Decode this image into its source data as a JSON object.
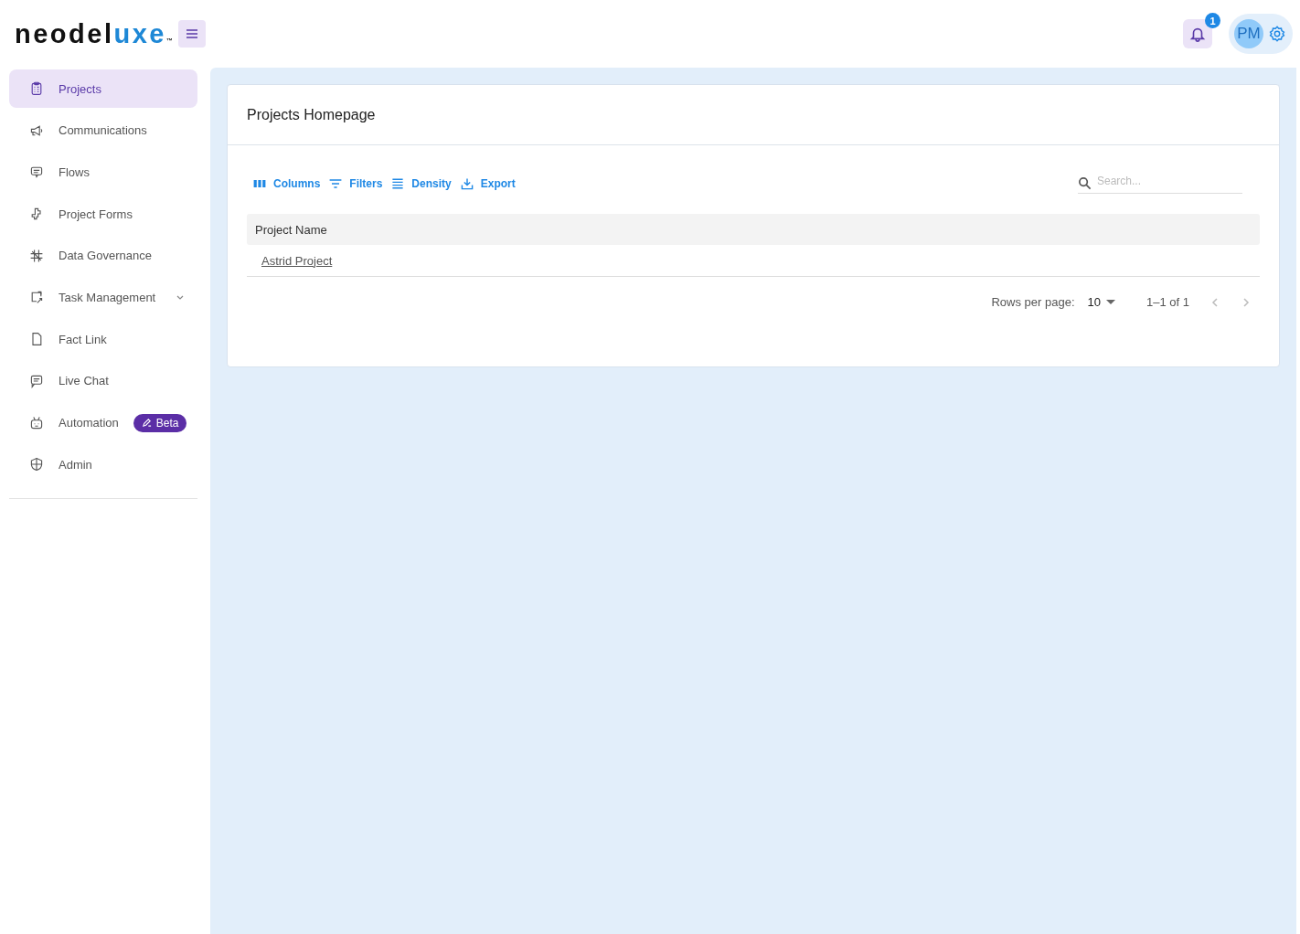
{
  "logo": {
    "text": "neodel",
    "accent": "uxe",
    "mark": "™"
  },
  "header": {
    "notifications": "1",
    "avatar": "PM"
  },
  "sidebar": {
    "items": [
      {
        "label": "Projects",
        "selected": true
      },
      {
        "label": "Communications",
        "selected": false
      },
      {
        "label": "Flows",
        "selected": false
      },
      {
        "label": "Project Forms",
        "selected": false
      },
      {
        "label": "Data Governance",
        "selected": false
      },
      {
        "label": "Task Management",
        "selected": false,
        "expanded": false
      },
      {
        "label": "Fact Link",
        "selected": false
      },
      {
        "label": "Live Chat",
        "selected": false
      },
      {
        "label": "Automation",
        "selected": false,
        "badge": "Beta"
      },
      {
        "label": "Admin",
        "selected": false
      }
    ]
  },
  "card": {
    "title": "Projects Homepage",
    "toolbar": [
      "Columns",
      "Filters",
      "Density",
      "Export"
    ],
    "search": {
      "placeholder": "Search..."
    },
    "table": {
      "columns": [
        "Project Name"
      ],
      "rows": [
        [
          "Astrid Project"
        ]
      ]
    },
    "pagination": {
      "rows_label": "Rows per page:",
      "rows_value": "10",
      "range": "1–1 of 1"
    }
  }
}
